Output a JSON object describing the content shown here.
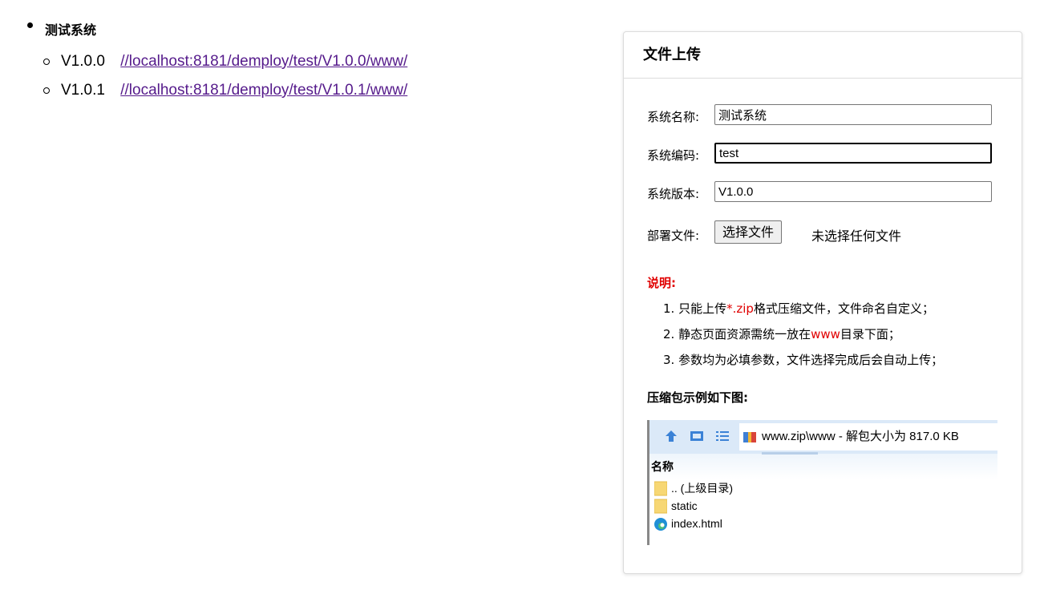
{
  "systems": [
    {
      "name": "测试系统",
      "versions": [
        {
          "version": "V1.0.0",
          "url": "//localhost:8181/demploy/test/V1.0.0/www/"
        },
        {
          "version": "V1.0.1",
          "url": "//localhost:8181/demploy/test/V1.0.1/www/"
        }
      ]
    }
  ],
  "upload_panel": {
    "title": "文件上传",
    "fields": {
      "system_name": {
        "label": "系统名称:",
        "value": "测试系统"
      },
      "system_code": {
        "label": "系统编码:",
        "value": "test"
      },
      "system_version": {
        "label": "系统版本:",
        "value": "V1.0.0"
      },
      "deploy_file": {
        "label": "部署文件:",
        "button": "选择文件",
        "status": "未选择任何文件"
      }
    },
    "notes": {
      "title": "说明:",
      "items": [
        {
          "num": "1.",
          "pre": "只能上传",
          "highlight": "*.zip",
          "post": "格式压缩文件，文件命名自定义；"
        },
        {
          "num": "2.",
          "pre": "静态页面资源需统一放在",
          "highlight": "www",
          "post": "目录下面；"
        },
        {
          "num": "3.",
          "pre": "参数均为必填参数，文件选择完成后会自动上传；",
          "highlight": "",
          "post": ""
        }
      ]
    },
    "example": {
      "title": "压缩包示例如下图:",
      "path": "www.zip\\www - 解包大小为 817.0 KB",
      "column": "名称",
      "rows": [
        {
          "name": ".. (上级目录)",
          "icon": "folder-icon"
        },
        {
          "name": "static",
          "icon": "folder-icon"
        },
        {
          "name": "index.html",
          "icon": "edge-browser-icon"
        }
      ]
    }
  },
  "colors": {
    "link": "#551a8b",
    "note_red": "#e00000",
    "explorer_bar": "#dbe9f8"
  }
}
